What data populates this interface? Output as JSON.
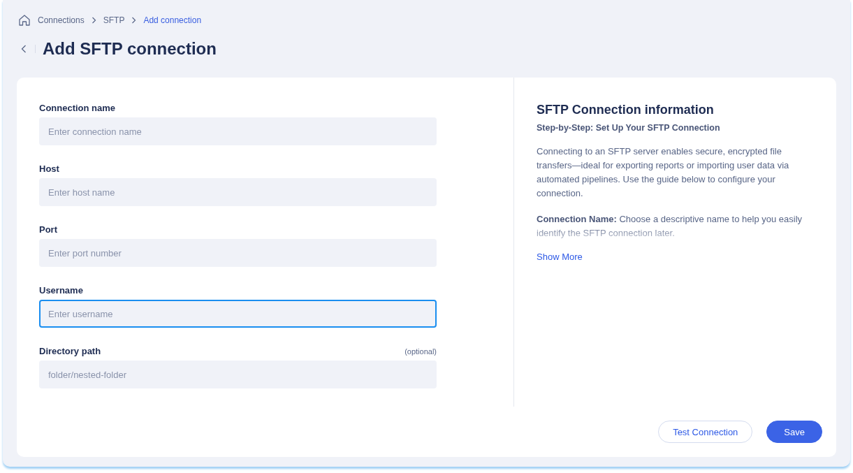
{
  "breadcrumbs": [
    {
      "label": "Connections",
      "current": false
    },
    {
      "label": "SFTP",
      "current": false
    },
    {
      "label": "Add connection",
      "current": true
    }
  ],
  "title": "Add SFTP connection",
  "fields": [
    {
      "label": "Connection name",
      "placeholder": "Enter connection name",
      "focused": false
    },
    {
      "label": "Host",
      "placeholder": "Enter host name",
      "focused": false
    },
    {
      "label": "Port",
      "placeholder": "Enter port number",
      "focused": false
    },
    {
      "label": "Username",
      "placeholder": "Enter username",
      "focused": true
    },
    {
      "label": "Directory path",
      "placeholder": "folder/nested-folder",
      "focused": false,
      "note": "(optional)"
    }
  ],
  "info": {
    "title": "SFTP Connection information",
    "subtitle": "Step-by-Step: Set Up Your SFTP Connection",
    "paragraphs": [
      "Connecting to an SFTP server enables secure, encrypted file transfers—ideal for exporting reports or importing user data via automated pipelines. Use the guide below to configure your connection.",
      "**Connection Name:** Choose a descriptive name to help you easily identify the SFTP connection later."
    ],
    "show_more": "Show More"
  },
  "buttons": [
    {
      "label": "Test Connection",
      "kind": "secondary"
    },
    {
      "label": "Save",
      "kind": "primary"
    }
  ]
}
